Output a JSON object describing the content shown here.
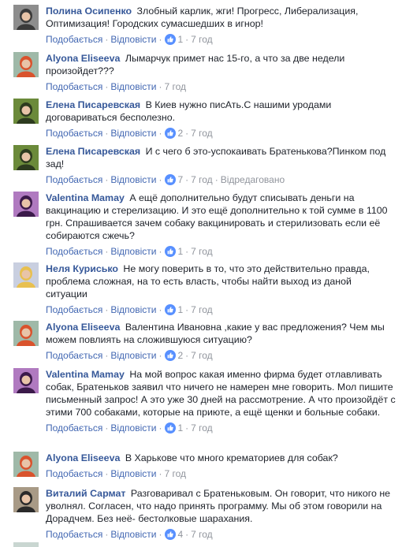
{
  "comments": [
    {
      "author": "Полина Осипенко",
      "text": "Злобный карлик, жги! Прогресс, Либерализация, Оптимизация! Городских сумасшедших в игнор!",
      "like_label": "Подобається",
      "reply_label": "Відповісти",
      "reactions": "1",
      "time": "7 год",
      "edited": "",
      "avatar_color": "#3a3a3a",
      "avatar_bg": "#8d8d8d"
    },
    {
      "author": "Alyona Eliseeva",
      "text": "Лымарчук примет нас 15-го, а что за две недели произойдет???",
      "like_label": "Подобається",
      "reply_label": "Відповісти",
      "reactions": "",
      "time": "7 год",
      "edited": "",
      "avatar_color": "#d9532d",
      "avatar_bg": "#9fb9a8"
    },
    {
      "author": "Елена Писаревская",
      "text": "В Киев нужно писАть.С нашими уродами договариваться бесполезно.",
      "like_label": "Подобається",
      "reply_label": "Відповісти",
      "reactions": "2",
      "time": "7 год",
      "edited": "",
      "avatar_color": "#2d3b1f",
      "avatar_bg": "#6b8a3a"
    },
    {
      "author": "Елена Писаревская",
      "text": "И с чего б это-успокаивать Братенькова?Пинком под зад!",
      "like_label": "Подобається",
      "reply_label": "Відповісти",
      "reactions": "7",
      "time": "7 год",
      "edited": "Відредаговано",
      "avatar_color": "#2d3b1f",
      "avatar_bg": "#6b8a3a"
    },
    {
      "author": "Valentina Mamay",
      "text": "А ещё дополнительно будут списывать деньги на вакцинацию и стерелизацию. И это ещё дополнительно к той сумме в 1100 грн. Спрашивается зачем собаку вакцинировать и стерилизовать если её собираются сжечь?",
      "like_label": "Подобається",
      "reply_label": "Відповісти",
      "reactions": "1",
      "time": "7 год",
      "edited": "",
      "avatar_color": "#3b1a4a",
      "avatar_bg": "#b07ac0"
    },
    {
      "author": "Неля Курисько",
      "text": "Не могу поверить в то, что это действительно правда, проблема сложная, на то есть власть, чтобы найти выход из даной ситуации",
      "like_label": "Подобається",
      "reply_label": "Відповісти",
      "reactions": "1",
      "time": "7 год",
      "edited": "",
      "avatar_color": "#e8c050",
      "avatar_bg": "#c9cfe0"
    },
    {
      "author": "Alyona Eliseeva",
      "text": "Валентина Ивановна ,какие у вас предложения? Чем мы можем повлиять на сложившуюся ситуацию?",
      "like_label": "Подобається",
      "reply_label": "Відповісти",
      "reactions": "2",
      "time": "7 год",
      "edited": "",
      "avatar_color": "#d9532d",
      "avatar_bg": "#9fb9a8"
    },
    {
      "author": "Valentina Mamay",
      "text": "На мой вопрос какая именно фирма будет отлавливать собак, Братеньков заявил что ничего не намерен мне говорить. Мол пишите письменный запрос! А это уже 30 дней на рассмотрение. А что произойдёт с этими 700 собаками, которые на приюте, а ещё щенки и больные собаки.",
      "like_label": "Подобається",
      "reply_label": "Відповісти",
      "reactions": "1",
      "time": "7 год",
      "edited": "",
      "avatar_color": "#3b1a4a",
      "avatar_bg": "#b07ac0"
    },
    {
      "author": "Alyona Eliseeva",
      "text": "В Харькове что много крематориев для собак?",
      "like_label": "Подобається",
      "reply_label": "Відповісти",
      "reactions": "",
      "time": "7 год",
      "edited": "",
      "avatar_color": "#d9532d",
      "avatar_bg": "#9fb9a8"
    },
    {
      "author": "Виталий Сармат",
      "text": "Разговаривал с Братеньковым. Он говорит, что никого не уволнял. Согласен, что надо принять программу. Мы об этом говорили на Дорадчем. Без неё- бестолковые шарахания.",
      "like_label": "Подобається",
      "reply_label": "Відповісти",
      "reactions": "4",
      "time": "7 год",
      "edited": "",
      "avatar_color": "#2a2a2a",
      "avatar_bg": "#a89a86"
    }
  ],
  "colors": {
    "link": "#365899",
    "action_link": "#4267b2",
    "meta": "#90949c",
    "like_badge": "#5890ff"
  },
  "icons": {
    "reaction": "like-thumb-icon"
  }
}
